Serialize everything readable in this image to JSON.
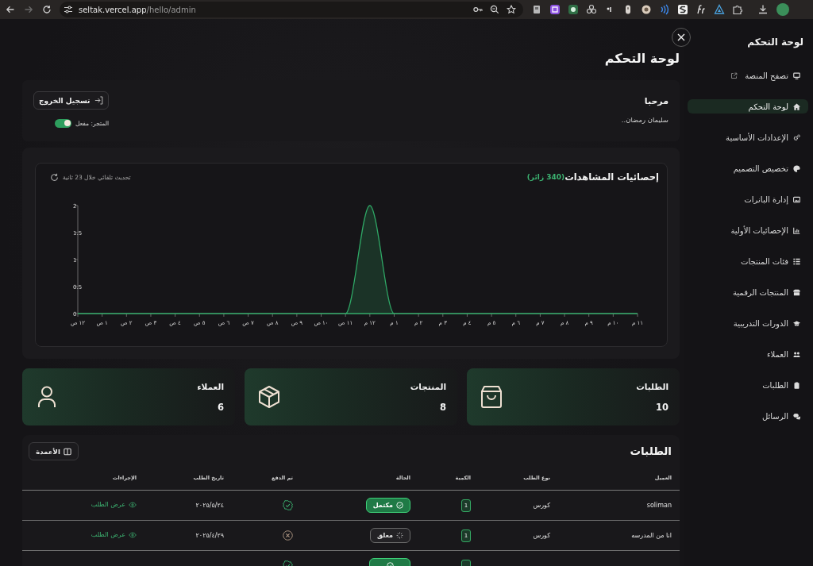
{
  "browser": {
    "nav": {
      "back_disabled": false,
      "forward_disabled": true
    },
    "url_host": "seltak.vercel.app",
    "url_path": "/hello/admin"
  },
  "sidebar": {
    "title": "لوحة التحكم",
    "items": [
      {
        "label": "تصفح المنصة",
        "kind": "browse",
        "external": true,
        "selected": false
      },
      {
        "label": "لوحة التحكم",
        "kind": "dashboard",
        "external": false,
        "selected": true
      },
      {
        "label": "الإعدادات الأساسية",
        "kind": "settings",
        "external": false,
        "selected": false
      },
      {
        "label": "تخصيص التصميم",
        "kind": "design",
        "external": false,
        "selected": false
      },
      {
        "label": "إدارة البانرات",
        "kind": "banners",
        "external": false,
        "selected": false
      },
      {
        "label": "الإحصائيات الأولية",
        "kind": "stats",
        "external": false,
        "selected": false
      },
      {
        "label": "فئات المنتجات",
        "kind": "categories",
        "external": false,
        "selected": false
      },
      {
        "label": "المنتجات الرقمية",
        "kind": "products",
        "external": false,
        "selected": false
      },
      {
        "label": "الدورات التدريبية",
        "kind": "courses",
        "external": false,
        "selected": false
      },
      {
        "label": "العملاء",
        "kind": "customers",
        "external": false,
        "selected": false
      },
      {
        "label": "الطلبات",
        "kind": "orders",
        "external": false,
        "selected": false
      },
      {
        "label": "الرسائل",
        "kind": "messages",
        "external": false,
        "selected": false
      }
    ]
  },
  "page": {
    "title": "لوحة التحكم"
  },
  "welcome": {
    "greeting": "مرحبا",
    "name": "سليمان رمضان..",
    "logout_button": "تسجيل الخروج",
    "store_toggle": {
      "label": "المتجر: مفعل",
      "on": true
    }
  },
  "views": {
    "title": "إحصائيات المشاهدات",
    "visitor_count": "(340 زائر)",
    "auto_refresh": "تحديث تلقائي خلال 23 ثانية",
    "chart_data": {
      "type": "area",
      "categories": [
        "١٢ ص",
        "١ ص",
        "٢ ص",
        "٣ ص",
        "٤ ص",
        "٥ ص",
        "٦ ص",
        "٧ ص",
        "٨ ص",
        "٩ ص",
        "١٠ ص",
        "١١ ص",
        "١٢ م",
        "١ م",
        "٢ م",
        "٣ م",
        "٤ م",
        "٥ م",
        "٦ م",
        "٧ م",
        "٨ م",
        "٩ م",
        "١٠ م",
        "١١ م"
      ],
      "values": [
        0,
        0,
        0,
        0,
        0,
        0,
        0,
        0,
        0,
        0,
        0,
        0,
        2,
        0,
        0,
        0,
        0,
        0,
        0,
        0,
        0,
        0,
        0,
        0
      ],
      "ylim": [
        0,
        2
      ],
      "yticks": [
        0,
        0.5,
        1,
        1.5,
        2
      ]
    }
  },
  "stats": [
    {
      "kind": "orders",
      "label": "الطلبات",
      "value": "10"
    },
    {
      "kind": "products",
      "label": "المنتجات",
      "value": "8"
    },
    {
      "kind": "customers",
      "label": "العملاء",
      "value": "6"
    }
  ],
  "orders": {
    "title": "الطلبات",
    "columns_button": "الأعمدة",
    "columns": [
      "العميل",
      "نوع الطلب",
      "الكمية",
      "الحالة",
      "تم الدفع",
      "تاريخ الطلب",
      "الإجراءات"
    ],
    "rows": [
      {
        "customer": "soliman",
        "type": "كورس",
        "quantity": "1",
        "status": {
          "kind": "completed",
          "label": "مكتمل"
        },
        "paid": true,
        "date": "٢٠٢٥/٥/٢٤",
        "action": "عرض الطلب"
      },
      {
        "customer": "انا من المدرسه",
        "type": "كورس",
        "quantity": "1",
        "status": {
          "kind": "pending",
          "label": "معلق"
        },
        "paid": false,
        "date": "٢٠٢٥/٤/٢٩",
        "action": "عرض الطلب"
      },
      {
        "status": {
          "kind": "completed"
        },
        "paid": true
      }
    ]
  }
}
